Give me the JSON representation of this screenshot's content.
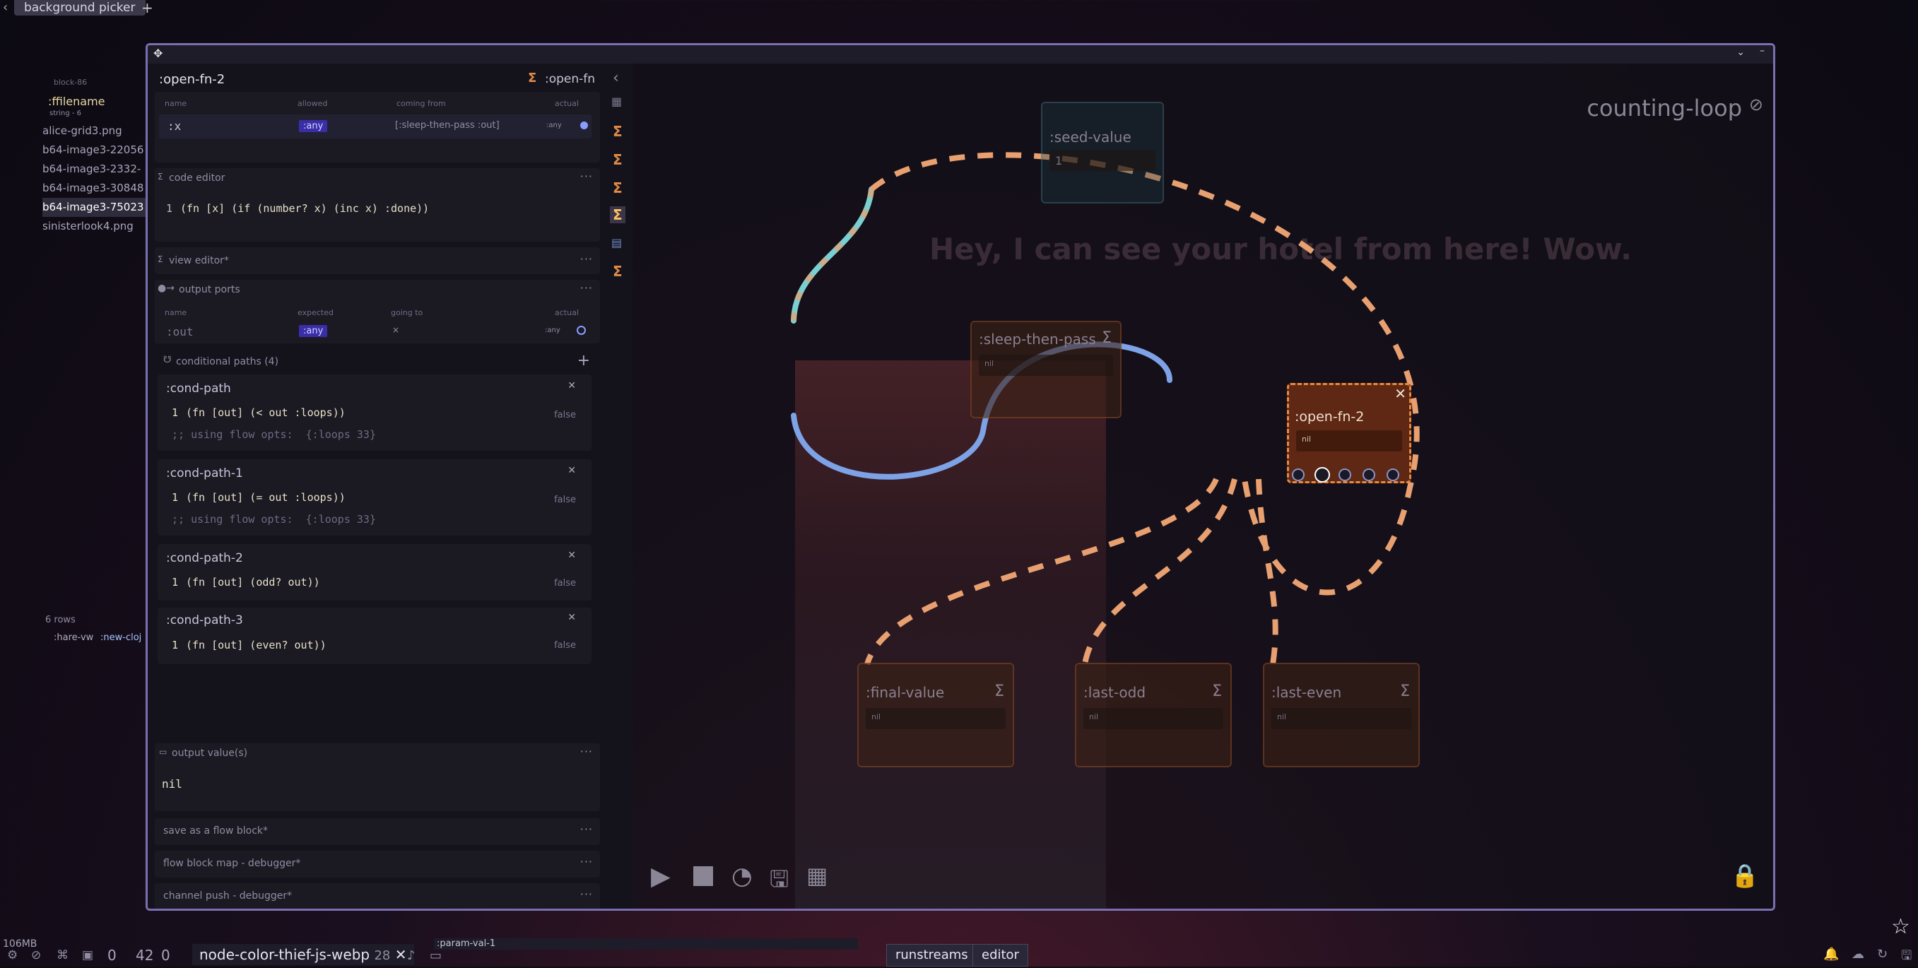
{
  "top_tabs": {
    "back": "‹",
    "active": "background picker",
    "add": "+"
  },
  "bg_list": {
    "header": "block-86",
    "field_name": ":ffilename",
    "field_type": "string - 6",
    "files": [
      "alice-grid3.png",
      "b64-image3-22056",
      "b64-image3-2332-",
      "b64-image3-30848",
      "b64-image3-75023",
      "sinisterlook4.png"
    ],
    "selected_index": 4,
    "rows_label": "6 rows",
    "tag1": ":hare-vw",
    "tag2": ":new-cloj"
  },
  "panel": {
    "title": ":open-fn-2",
    "type_label": ":open-fn",
    "inputs": {
      "cols": [
        "name",
        "allowed",
        "coming from",
        "actual"
      ],
      "row": {
        "name": ":x",
        "allowed": ":any",
        "from": "[:sleep-then-pass :out]",
        "actual": ":any"
      }
    },
    "code_editor": {
      "label": "code editor",
      "line_no": "1",
      "code": "(fn [x] (if (number? x) (inc x) :done))"
    },
    "view_editor": "view editor*",
    "output_ports": {
      "label": "output ports",
      "cols": [
        "name",
        "expected",
        "going to",
        "actual"
      ],
      "row": {
        "name": ":out",
        "expected": ":any",
        "going_to": "×",
        "actual": ":any"
      }
    },
    "conditional_paths": {
      "label": "conditional paths (4)",
      "add": "+",
      "items": [
        {
          "name": ":cond-path",
          "code": "(fn [out] (< out :loops))",
          "comment": ";; using flow opts:  {:loops 33}",
          "status": "false"
        },
        {
          "name": ":cond-path-1",
          "code": "(fn [out] (= out :loops))",
          "comment": ";; using flow opts:  {:loops 33}",
          "status": "false"
        },
        {
          "name": ":cond-path-2",
          "code": "(fn [out] (odd? out))",
          "comment": "",
          "status": "false"
        },
        {
          "name": ":cond-path-3",
          "code": "(fn [out] (even? out))",
          "comment": "",
          "status": "false"
        }
      ]
    },
    "output_values": {
      "label": "output value(s)",
      "value": "nil"
    },
    "save_block": "save as a flow block*",
    "debugger1": "flow block map - debugger*",
    "debugger2": "channel push - debugger*"
  },
  "canvas": {
    "flow_title": "counting-loop",
    "bg_text": "Hey, I can see your hotel from here! Wow.",
    "nodes": {
      "seed": {
        "title": ":seed-value",
        "value": "1"
      },
      "sleep": {
        "title": ":sleep-then-pass",
        "value": "nil"
      },
      "open": {
        "title": ":open-fn-2",
        "value": "nil"
      },
      "final": {
        "title": ":final-value",
        "value": "nil"
      },
      "odd": {
        "title": ":last-odd",
        "value": "nil"
      },
      "even": {
        "title": ":last-even",
        "value": "nil"
      }
    }
  },
  "statusbar": {
    "memory": "106MB",
    "counter1": "0",
    "counter2": "42",
    "counter3": "0",
    "active_tab": "node-color-thief-js-webp",
    "active_tab_count": "28",
    "param": ":param-val-1",
    "btn_runstreams": "runstreams",
    "btn_editor": "editor"
  },
  "colors": {
    "accent": "#7b6fb0",
    "flow_orange": "#e8a070",
    "flow_blue": "#7ea2e6",
    "flow_teal": "#7ad0d0"
  }
}
